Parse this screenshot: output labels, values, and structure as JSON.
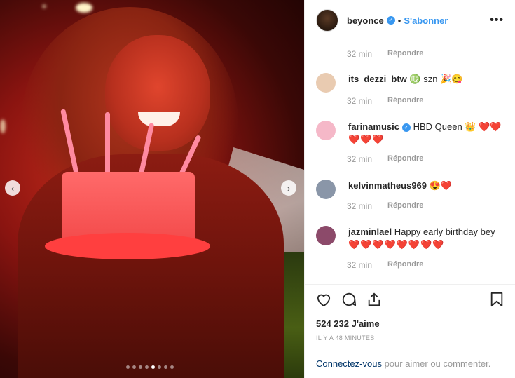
{
  "header": {
    "username": "beyonce",
    "separator": "•",
    "follow_label": "S'abonner",
    "more_label": "•••"
  },
  "carousel": {
    "prev": "‹",
    "next": "›",
    "slide_count": 8,
    "active_index": 4
  },
  "comments": [
    {
      "kind": "meta",
      "time": "32 min",
      "reply": "Répondre"
    },
    {
      "kind": "comment",
      "user": "its_dezzi_btw",
      "text": "♍ szn 🎉😋",
      "avatar_color": "#e9cbb1"
    },
    {
      "kind": "meta",
      "time": "32 min",
      "reply": "Répondre"
    },
    {
      "kind": "comment",
      "user": "farinamusic",
      "verified": true,
      "text": "HBD Queen 👑 ❤️❤️",
      "hearts": "❤️❤️❤️",
      "avatar_color": "#f5b8c8"
    },
    {
      "kind": "meta",
      "time": "32 min",
      "reply": "Répondre"
    },
    {
      "kind": "comment",
      "user": "kelvinmatheus969",
      "text": "😍❤️",
      "avatar_color": "#8a96a8"
    },
    {
      "kind": "meta",
      "time": "32 min",
      "reply": "Répondre"
    },
    {
      "kind": "comment",
      "user": "jazminlael",
      "text": "Happy early birthday bey",
      "hearts": "❤️❤️❤️❤️❤️❤️❤️❤️",
      "avatar_color": "#8c4a6a"
    },
    {
      "kind": "meta",
      "time": "32 min",
      "reply": "Répondre"
    }
  ],
  "actions": {
    "like_icon": "heart-outline-icon",
    "comment_icon": "comment-bubble-icon",
    "share_icon": "share-upload-icon",
    "save_icon": "bookmark-icon",
    "likes": "524 232 J'aime",
    "time": "IL Y A 48 MINUTES"
  },
  "login": {
    "link": "Connectez-vous",
    "text": " pour aimer ou commenter."
  }
}
